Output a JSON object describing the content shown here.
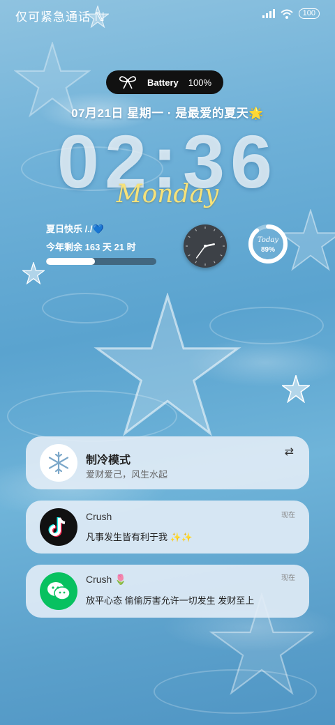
{
  "status_bar": {
    "carrier": "仅可紧急通话",
    "battery": "100",
    "icons": [
      "nfc-icon",
      "signal-icon",
      "wifi-icon",
      "battery-icon"
    ]
  },
  "battery_pill": {
    "icon": "bow-icon",
    "label": "Battery",
    "value": "100%"
  },
  "date_line": "07月21日 星期一 · 是最爱的夏天🌟",
  "clock": "02:36",
  "weekday": "Monday",
  "countdown": {
    "title": "夏日快乐 /./💙",
    "remaining": "今年剩余 163 天 21 时",
    "progress": 0.44
  },
  "analog_clock": {
    "hour": 2,
    "minute": 36
  },
  "ring_widget": {
    "label": "Today",
    "value_text": "89%",
    "value": 0.89
  },
  "notifications": [
    {
      "title": "制冷模式",
      "body": "爱财爱己，风生水起",
      "icon": "snowflake-icon",
      "action_icon": "swap-icon"
    },
    {
      "title": "Crush",
      "body": "凡事发生皆有利于我 ✨✨",
      "time": "现在",
      "icon": "tiktok-icon"
    },
    {
      "title": "Crush 🌷",
      "body": "放平心态 偷偷厉害允许一切发生 发财至上",
      "time": "现在",
      "icon": "wechat-icon"
    }
  ],
  "colors": {
    "accent_yellow": "#f6e27a",
    "card_bg": "#e2ecf6",
    "pill_bg": "#111111"
  }
}
